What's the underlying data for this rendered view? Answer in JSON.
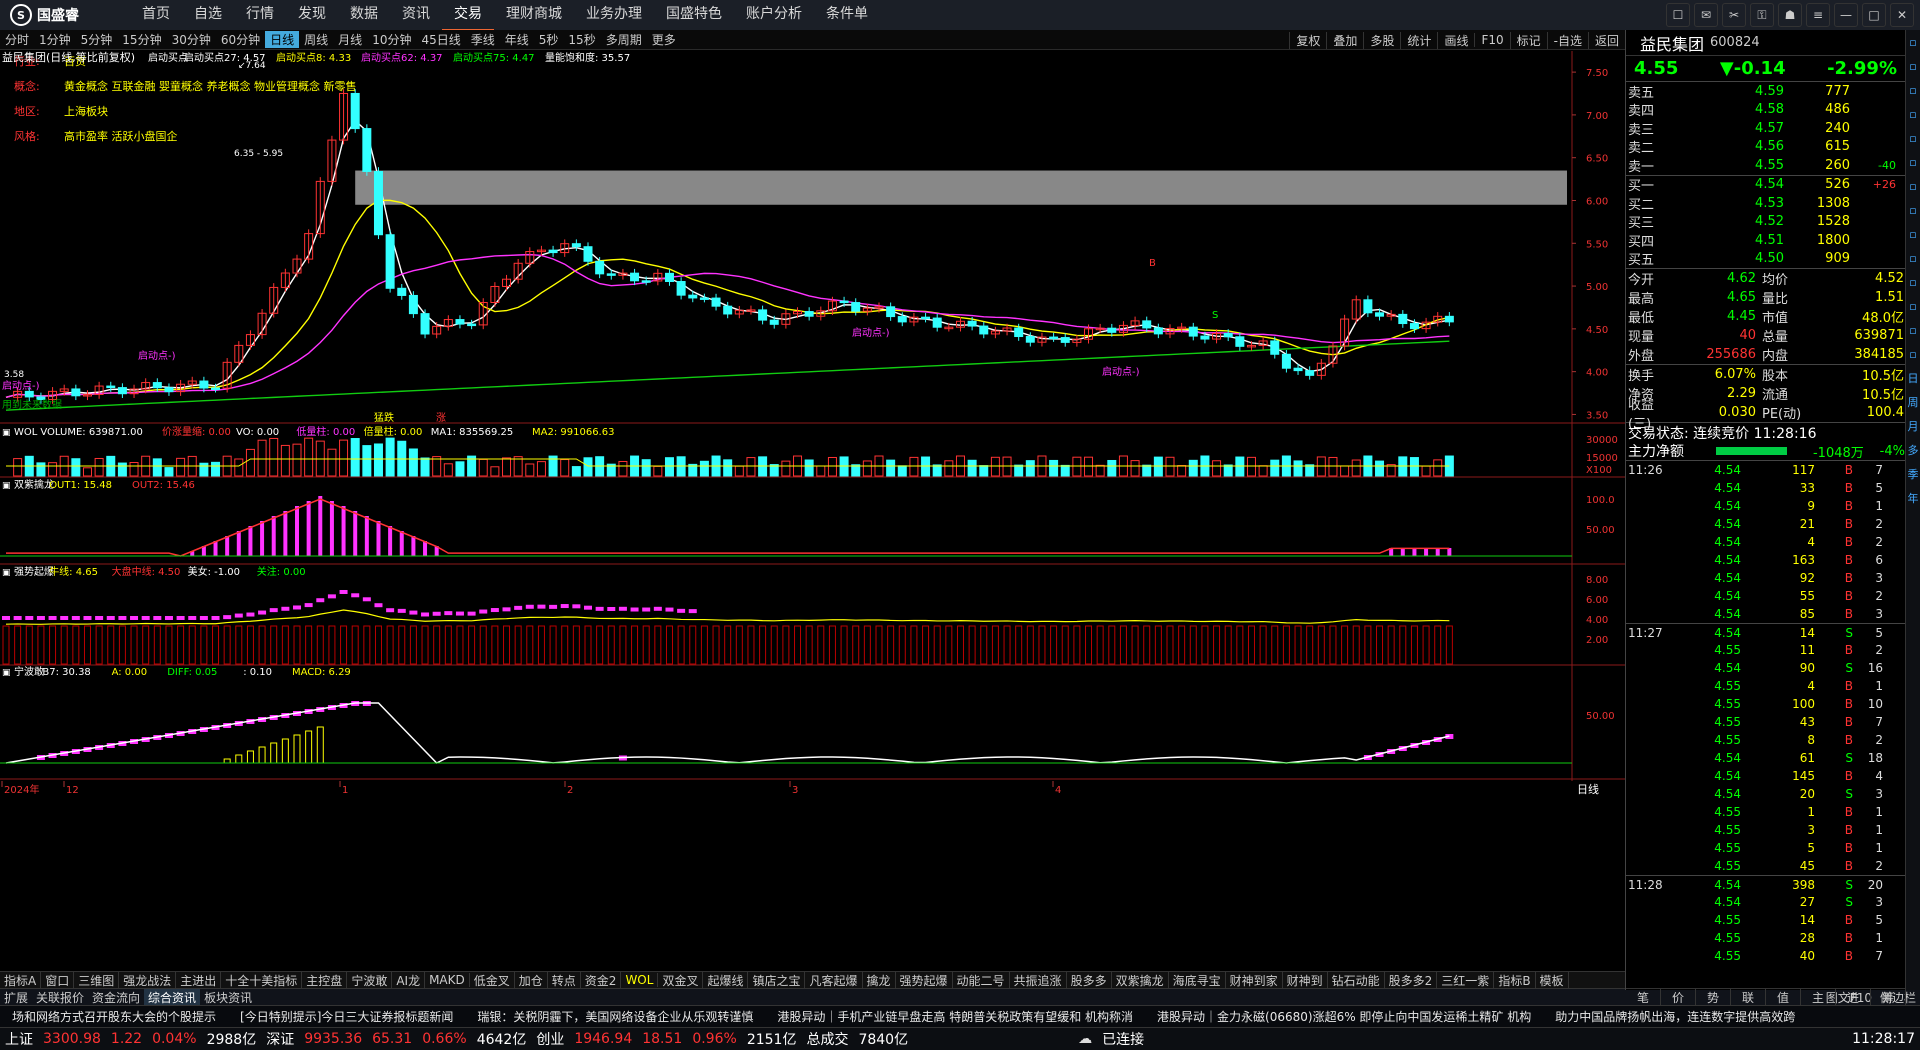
{
  "app": {
    "logo": "国盛睿",
    "menu": [
      "首页",
      "自选",
      "行情",
      "发现",
      "数据",
      "资讯",
      "交易",
      "理财商城",
      "业务办理",
      "国盛特色",
      "账户分析",
      "条件单"
    ],
    "active_menu": "交易"
  },
  "periods": [
    "分时",
    "1分钟",
    "5分钟",
    "15分钟",
    "30分钟",
    "60分钟",
    "日线",
    "周线",
    "月线",
    "10分钟",
    "45日线",
    "季线",
    "年线",
    "5秒",
    "15秒",
    "多周期",
    "更多"
  ],
  "active_period": "日线",
  "toolbar": [
    "复权",
    "叠加",
    "多股",
    "统计",
    "画线",
    "F10",
    "标记",
    "-自选",
    "返回"
  ],
  "main_legend": {
    "title": "益民集团(日线,等比前复权)",
    "items": [
      {
        "t": "启动买点",
        "c": "#fff"
      },
      {
        "t": "启动买点27: 4.57",
        "c": "#fff"
      },
      {
        "t": "启动买点8: 4.33",
        "c": "#ff0"
      },
      {
        "t": "启动买点62: 4.37",
        "c": "#f3f"
      },
      {
        "t": "启动买点75: 4.47",
        "c": "#0f0"
      },
      {
        "t": "量能饱和度: 35.57",
        "c": "#fff"
      }
    ]
  },
  "stock_info": [
    {
      "k": "行业:",
      "v": "百货"
    },
    {
      "k": "概念:",
      "v": "黄金概念 互联金融 婴童概念 养老概念 物业管理概念 新零售"
    },
    {
      "k": "地区:",
      "v": "上海板块"
    },
    {
      "k": "风格:",
      "v": "高市盈率 活跃小盘国企"
    }
  ],
  "annotations": {
    "high": "7.64",
    "zone": "6.35 - 5.95",
    "low": "3.58",
    "start_point": "启动点-)",
    "future": "用到未来数据",
    "boom": "猛跌",
    "up": "涨",
    "b_mark": "B",
    "s_mark": "S"
  },
  "price_axis": [
    "7.50",
    "7.00",
    "6.50",
    "6.00",
    "5.50",
    "5.00",
    "4.50",
    "4.00",
    "3.50"
  ],
  "volume_legend": [
    {
      "t": "WOL",
      "c": "#fff"
    },
    {
      "t": "VOLUME: 639871.00",
      "c": "#fff"
    },
    {
      "t": "价涨量缩: 0.00",
      "c": "#f33"
    },
    {
      "t": "VO: 0.00",
      "c": "#fff"
    },
    {
      "t": "低量柱: 0.00",
      "c": "#f3f"
    },
    {
      "t": "倍量柱: 0.00",
      "c": "#ff0"
    },
    {
      "t": "MA1: 835569.25",
      "c": "#fff"
    },
    {
      "t": "MA2: 991066.63",
      "c": "#ff0"
    }
  ],
  "volume_axis": [
    "30000",
    "15000",
    "X100"
  ],
  "ind1_legend": [
    {
      "t": "双紫擒龙",
      "c": "#fff"
    },
    {
      "t": "OUT1: 15.48",
      "c": "#ff0"
    },
    {
      "t": "OUT2: 15.46",
      "c": "#f33"
    }
  ],
  "ind1_axis": [
    "100.0",
    "50.00"
  ],
  "ind2_legend": [
    {
      "t": "强势起爆",
      "c": "#fff"
    },
    {
      "t": "牛线: 4.65",
      "c": "#ff0"
    },
    {
      "t": "大盘中线: 4.50",
      "c": "#f33"
    },
    {
      "t": "美女: -1.00",
      "c": "#fff"
    },
    {
      "t": "关注: 0.00",
      "c": "#0f0"
    }
  ],
  "ind2_axis": [
    "8.00",
    "6.00",
    "4.00",
    "2.00"
  ],
  "ind3_legend": [
    {
      "t": "宁波敢",
      "c": "#fff"
    },
    {
      "t": "B7: 30.38",
      "c": "#fff"
    },
    {
      "t": "A: 0.00",
      "c": "#ff0"
    },
    {
      "t": "DIFF: 0.05",
      "c": "#0f0"
    },
    {
      "t": ": 0.10",
      "c": "#fff"
    },
    {
      "t": "MACD: 6.29",
      "c": "#ff0"
    }
  ],
  "ind3_axis": [
    "50.00"
  ],
  "date_axis": [
    "2024年",
    "12",
    "1",
    "2",
    "3",
    "4"
  ],
  "date_footer": "日线",
  "indicator_tabs": [
    "指标A",
    "窗口",
    "三维图",
    "强龙战法",
    "主进出",
    "十全十美指标",
    "主控盘",
    "宁波敢",
    "AI龙",
    "MAKD",
    "低金叉",
    "加仓",
    "转点",
    "资金2",
    "WOL",
    "双金叉",
    "起爆线",
    "镇店之宝",
    "凡客起爆",
    "擒龙",
    "强势起爆",
    "动能二号",
    "共振追涨",
    "股多多",
    "双紫擒龙",
    "海底寻宝",
    "财神到家",
    "财神到",
    "钻石动能",
    "股多多2",
    "三红一紫",
    "指标B",
    "模板"
  ],
  "active_tab": "WOL",
  "news_tabs": [
    "扩展",
    "关联报价",
    "资金流向",
    "综合资讯",
    "板块资讯"
  ],
  "bottom_right_tabs": [
    "图文F10",
    "侧边栏"
  ],
  "quote": {
    "name": "益民集团",
    "code": "600824",
    "price": "4.55",
    "change": "▼-0.14",
    "pct": "-2.99%",
    "asks": [
      {
        "l": "卖五",
        "p": "4.59",
        "v": "777",
        "d": ""
      },
      {
        "l": "卖四",
        "p": "4.58",
        "v": "486",
        "d": ""
      },
      {
        "l": "卖三",
        "p": "4.57",
        "v": "240",
        "d": ""
      },
      {
        "l": "卖二",
        "p": "4.56",
        "v": "615",
        "d": ""
      },
      {
        "l": "卖一",
        "p": "4.55",
        "v": "260",
        "d": "-40"
      }
    ],
    "bids": [
      {
        "l": "买一",
        "p": "4.54",
        "v": "526",
        "d": "+26"
      },
      {
        "l": "买二",
        "p": "4.53",
        "v": "1308",
        "d": ""
      },
      {
        "l": "买三",
        "p": "4.52",
        "v": "1528",
        "d": ""
      },
      {
        "l": "买四",
        "p": "4.51",
        "v": "1800",
        "d": ""
      },
      {
        "l": "买五",
        "p": "4.50",
        "v": "909",
        "d": ""
      }
    ],
    "stats": [
      {
        "a": "今开",
        "b": "4.62",
        "bc": "#0f0",
        "c": "均价",
        "d": "4.52"
      },
      {
        "a": "最高",
        "b": "4.65",
        "bc": "#0f0",
        "c": "量比",
        "d": "1.51"
      },
      {
        "a": "最低",
        "b": "4.45",
        "bc": "#0f0",
        "c": "市值",
        "d": "48.0亿"
      },
      {
        "a": "现量",
        "b": "40",
        "bc": "#f33",
        "c": "总量",
        "d": "639871"
      },
      {
        "a": "外盘",
        "b": "255686",
        "bc": "#f33",
        "c": "内盘",
        "d": "384185"
      }
    ],
    "stats2": [
      {
        "a": "换手",
        "b": "6.07%",
        "c": "股本",
        "d": "10.5亿"
      },
      {
        "a": "净资",
        "b": "2.29",
        "c": "流通",
        "d": "10.5亿"
      },
      {
        "a": "收益(三)",
        "b": "0.030",
        "c": "PE(动)",
        "d": "100.4"
      }
    ],
    "status": "交易状态: 连续竞价 11:28:16",
    "mainforce": {
      "label": "主力净额",
      "value": "-1048万",
      "pct": "-4%"
    },
    "ticks": [
      {
        "t": "11:26",
        "p": "4.54",
        "v": "117",
        "d": "B",
        "n": "7"
      },
      {
        "t": "",
        "p": "4.54",
        "v": "33",
        "d": "B",
        "n": "5"
      },
      {
        "t": "",
        "p": "4.54",
        "v": "9",
        "d": "B",
        "n": "1"
      },
      {
        "t": "",
        "p": "4.54",
        "v": "21",
        "d": "B",
        "n": "2"
      },
      {
        "t": "",
        "p": "4.54",
        "v": "4",
        "d": "B",
        "n": "2"
      },
      {
        "t": "",
        "p": "4.54",
        "v": "163",
        "d": "B",
        "n": "6"
      },
      {
        "t": "",
        "p": "4.54",
        "v": "92",
        "d": "B",
        "n": "3"
      },
      {
        "t": "",
        "p": "4.54",
        "v": "55",
        "d": "B",
        "n": "2"
      },
      {
        "t": "",
        "p": "4.54",
        "v": "85",
        "d": "B",
        "n": "3"
      },
      {
        "t": "11:27",
        "p": "4.54",
        "v": "14",
        "d": "S",
        "n": "5"
      },
      {
        "t": "",
        "p": "4.55",
        "v": "11",
        "d": "B",
        "n": "2"
      },
      {
        "t": "",
        "p": "4.54",
        "v": "90",
        "d": "S",
        "n": "16"
      },
      {
        "t": "",
        "p": "4.55",
        "v": "4",
        "d": "B",
        "n": "1"
      },
      {
        "t": "",
        "p": "4.55",
        "v": "100",
        "d": "B",
        "n": "10"
      },
      {
        "t": "",
        "p": "4.55",
        "v": "43",
        "d": "B",
        "n": "7"
      },
      {
        "t": "",
        "p": "4.55",
        "v": "8",
        "d": "B",
        "n": "2"
      },
      {
        "t": "",
        "p": "4.54",
        "v": "61",
        "d": "S",
        "n": "18"
      },
      {
        "t": "",
        "p": "4.54",
        "v": "145",
        "d": "B",
        "n": "4"
      },
      {
        "t": "",
        "p": "4.54",
        "v": "20",
        "d": "S",
        "n": "3"
      },
      {
        "t": "",
        "p": "4.55",
        "v": "1",
        "d": "B",
        "n": "1"
      },
      {
        "t": "",
        "p": "4.55",
        "v": "3",
        "d": "B",
        "n": "1"
      },
      {
        "t": "",
        "p": "4.55",
        "v": "5",
        "d": "B",
        "n": "1"
      },
      {
        "t": "",
        "p": "4.55",
        "v": "45",
        "d": "B",
        "n": "2"
      },
      {
        "t": "11:28",
        "p": "4.54",
        "v": "398",
        "d": "S",
        "n": "20"
      },
      {
        "t": "",
        "p": "4.54",
        "v": "27",
        "d": "S",
        "n": "3"
      },
      {
        "t": "",
        "p": "4.55",
        "v": "14",
        "d": "B",
        "n": "5"
      },
      {
        "t": "",
        "p": "4.55",
        "v": "28",
        "d": "B",
        "n": "1"
      },
      {
        "t": "",
        "p": "4.55",
        "v": "40",
        "d": "B",
        "n": "7"
      }
    ]
  },
  "quote_tabs": [
    "笔",
    "价",
    "势",
    "联",
    "值",
    "主",
    "进",
    "筹"
  ],
  "sidebar": [
    "日",
    "周",
    "月",
    "多",
    "季",
    "年"
  ],
  "ticker": [
    "场和网络方式召开股东大会的个股提示",
    "[今日特别提示]今日三大证券报标题新闻",
    "瑞银：关税阴霾下，美国网络设备企业从乐观转谨慎",
    "港股异动｜手机产业链早盘走高 特朗普关税政策有望缓和 机构称消",
    "港股异动｜金力永磁(06680)涨超6% 即停止向中国发运稀土精矿 机构",
    "助力中国品牌扬帆出海，连连数字提供高效跨"
  ],
  "status": {
    "sh_label": "上证",
    "sh": "3300.98",
    "sh_chg": "1.22",
    "sh_pct": "0.04%",
    "sh_amt": "2988亿",
    "sz_label": "深证",
    "sz": "9935.36",
    "sz_chg": "65.31",
    "sz_pct": "0.66%",
    "sz_amt": "4642亿",
    "cy_label": "创业",
    "cy": "1946.94",
    "cy_chg": "18.51",
    "cy_pct": "0.96%",
    "cy_amt": "2151亿",
    "total_label": "总成交",
    "total": "7840亿",
    "conn": "已连接",
    "time": "11:28:17"
  },
  "chart_data": {
    "type": "candlestick",
    "title": "益民集团(日线,等比前复权)",
    "ylim": [
      3.4,
      7.7
    ],
    "high": 7.64,
    "low": 3.58
  }
}
